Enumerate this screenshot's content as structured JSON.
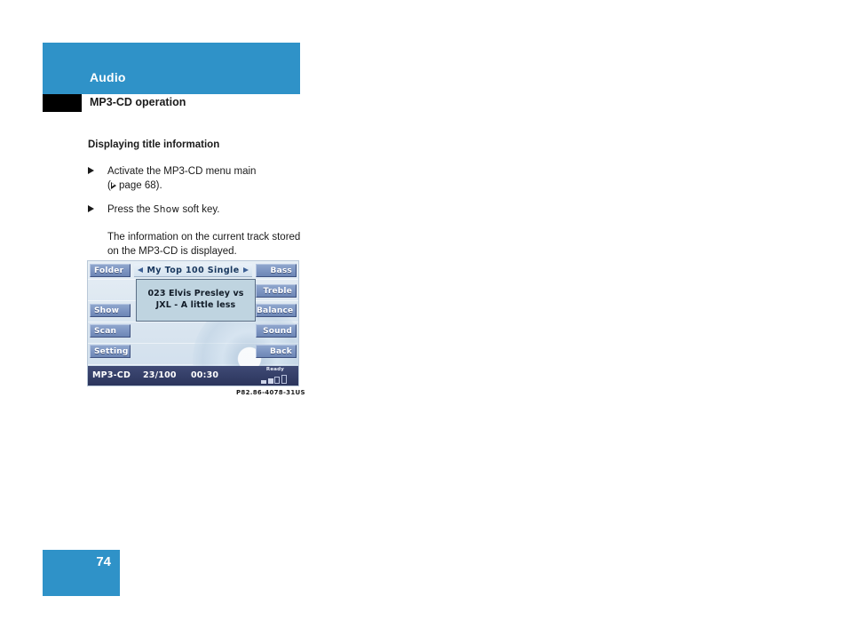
{
  "header": {
    "chapter_title": "Audio",
    "section_title": "MP3-CD operation",
    "accent_color": "#2f92c8",
    "tab_color": "#000000"
  },
  "content": {
    "body_heading": "Displaying title information",
    "steps": [
      {
        "line1": "Activate the MP3-CD menu main",
        "line2_prefix": "(",
        "line2_ref": " page 68).",
        "marker": "triangle-bullet"
      },
      {
        "prefix": "Press the ",
        "softkey": "Show",
        "suffix": " soft key.",
        "marker": "triangle-bullet"
      }
    ],
    "paragraph": "The information on the current track stored on the MP3-CD is displayed."
  },
  "device": {
    "title_strip": {
      "text": "My Top 100 Single",
      "nav_left_icon": "triangle-left-icon",
      "nav_right_icon": "triangle-right-icon"
    },
    "track_panel": {
      "line1": "023 Elvis Presley vs",
      "line2": "JXL - A little less"
    },
    "softkeys_left": [
      {
        "label": "Folder",
        "name": "folder"
      },
      {
        "label": "Show",
        "name": "show"
      },
      {
        "label": "Scan",
        "name": "scan"
      },
      {
        "label": "Setting",
        "name": "setting"
      }
    ],
    "softkeys_right": [
      {
        "label": "Bass",
        "name": "bass"
      },
      {
        "label": "Treble",
        "name": "treble"
      },
      {
        "label": "Balance",
        "name": "balance"
      },
      {
        "label": "Sound",
        "name": "sound"
      },
      {
        "label": "Back",
        "name": "back"
      }
    ],
    "status_bar": {
      "source": "MP3-CD",
      "track": "23/100",
      "elapsed": "00:30",
      "signal_label": "Ready",
      "signal_bars_total": 4,
      "signal_bars_filled": 2
    },
    "colors": {
      "softkey_blue": "#7d95c2",
      "status_bar": "#333d66",
      "track_panel_bg": "#bfd4e0"
    }
  },
  "figure": {
    "caption": "P82.86-4078-31US"
  },
  "footer": {
    "page_number": "74"
  }
}
